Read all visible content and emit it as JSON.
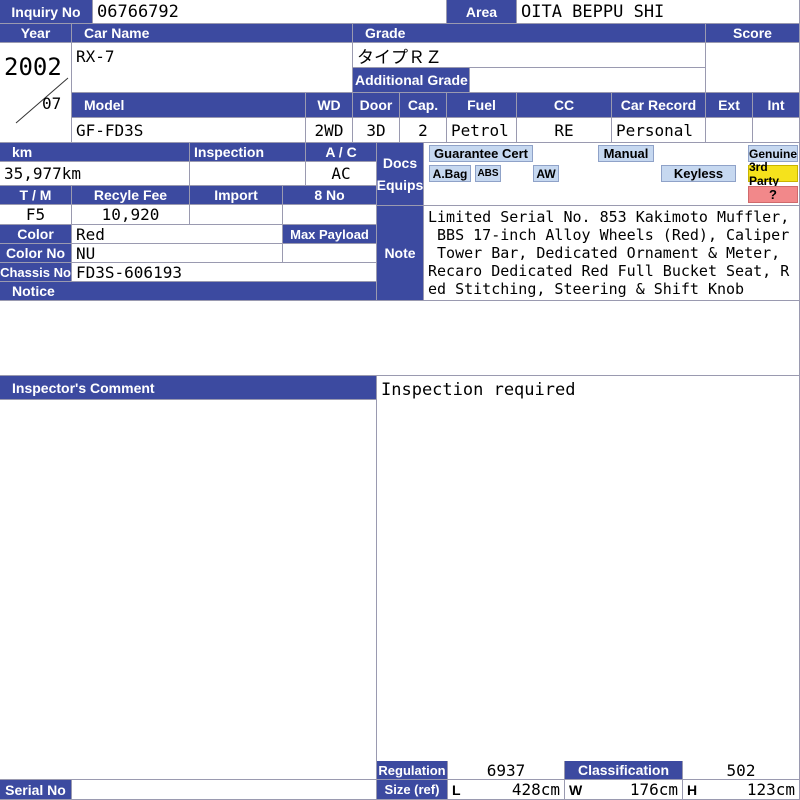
{
  "header": {
    "inquiry_label": "Inquiry No",
    "inquiry_value": "06766792",
    "area_label": "Area",
    "area_value": "OITA BEPPU SHI"
  },
  "row1": {
    "year_label": "Year",
    "car_name_label": "Car Name",
    "grade_label": "Grade",
    "score_label": "Score",
    "year": "2002",
    "month": "07",
    "car_name": "RX-7",
    "grade": "タイプＲＺ",
    "additional_grade_label": "Additional Grade",
    "score": ""
  },
  "row2": {
    "model_label": "Model",
    "wd_label": "WD",
    "door_label": "Door",
    "cap_label": "Cap.",
    "fuel_label": "Fuel",
    "cc_label": "CC",
    "car_record_label": "Car Record",
    "ext_label": "Ext",
    "int_label": "Int",
    "model": "GF-FD3S",
    "wd": "2WD",
    "door": "3D",
    "cap": "2",
    "fuel": "Petrol",
    "cc": "RE",
    "car_record": "Personal",
    "ext": "",
    "int": ""
  },
  "specs": {
    "km_label": "km",
    "inspection_label": "Inspection",
    "ac_label": "A / C",
    "km": "35,977km",
    "inspection": "",
    "ac": "AC",
    "tm_label": "T / M",
    "recycle_label": "Recyle Fee",
    "import_label": "Import",
    "eight_no_label": "8 No",
    "tm": "F5",
    "recycle": "10,920",
    "import": "",
    "eight_no": "",
    "color_label": "Color",
    "color": "Red",
    "max_payload_label": "Max Payload",
    "max_payload": "",
    "color_no_label": "Color No",
    "color_no": "NU",
    "chassis_label": "Chassis No",
    "chassis": "FD3S-606193",
    "notice_label": "Notice"
  },
  "docs": {
    "label_line1": "Docs",
    "label_line2": "Equips",
    "guarantee": "Guarantee Cert",
    "manual": "Manual",
    "genuine": "Genuine",
    "abag": "A.Bag",
    "abs": "ABS",
    "aw": "AW",
    "keyless": "Keyless",
    "third_party": "3rd Party",
    "question": "?"
  },
  "note": {
    "label": "Note",
    "text": "Limited Serial No. 853 Kakimoto Muffler,\n BBS 17-inch Alloy Wheels (Red), Caliper\n Tower Bar, Dedicated Ornament & Meter,\nRecaro Dedicated Red Full Bucket Seat, R\ned Stitching, Steering & Shift Knob"
  },
  "comment": {
    "label": "Inspector's Comment",
    "text": "Inspection required"
  },
  "footer": {
    "regulation_label": "Regulation",
    "regulation": "6937",
    "classification_label": "Classification",
    "classification": "502",
    "size_label": "Size (ref)",
    "l_label": "L",
    "l": "428cm",
    "w_label": "W",
    "w": "176cm",
    "h_label": "H",
    "h": "123cm",
    "serial_label": "Serial No",
    "serial": ""
  },
  "colors": {
    "header_bg": "#3c4aa0",
    "badge_bg": "#c6d8f0",
    "third_party_bg": "#f5e21c",
    "question_bg": "#f2888a"
  }
}
